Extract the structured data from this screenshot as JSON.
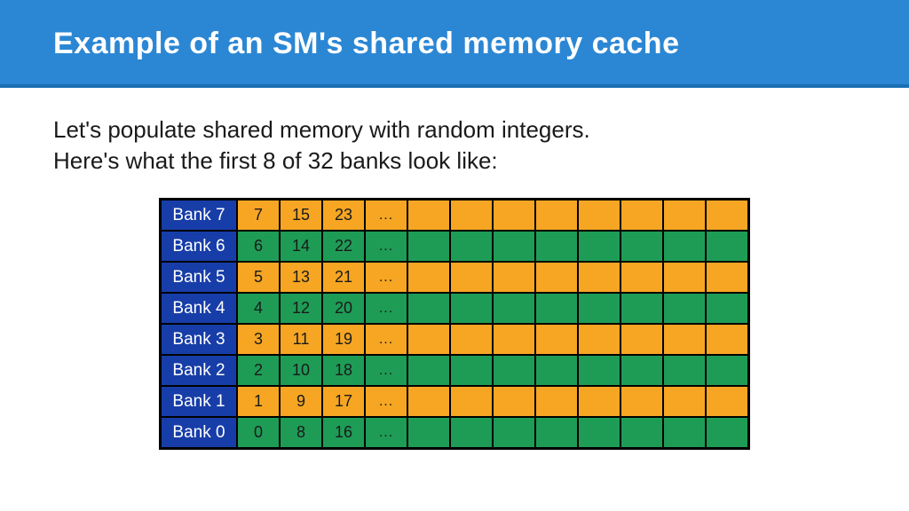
{
  "header": {
    "title": "Example of an SM's shared memory cache"
  },
  "intro": {
    "line1": "Let's populate shared memory with random integers.",
    "line2": "Here's what the first 8 of 32 banks look like:"
  },
  "colors": {
    "orange": "#f6a623",
    "green": "#1e9c56",
    "blue": "#173da8"
  },
  "chart_data": {
    "type": "table",
    "title": "First 8 of 32 shared-memory banks",
    "columns_shown": 12,
    "rows": [
      {
        "label": "Bank 7",
        "color": "orange",
        "cells": [
          "7",
          "15",
          "23",
          "..."
        ]
      },
      {
        "label": "Bank 6",
        "color": "green",
        "cells": [
          "6",
          "14",
          "22",
          "..."
        ]
      },
      {
        "label": "Bank 5",
        "color": "orange",
        "cells": [
          "5",
          "13",
          "21",
          "..."
        ]
      },
      {
        "label": "Bank 4",
        "color": "green",
        "cells": [
          "4",
          "12",
          "20",
          "..."
        ]
      },
      {
        "label": "Bank 3",
        "color": "orange",
        "cells": [
          "3",
          "11",
          "19",
          "..."
        ]
      },
      {
        "label": "Bank 2",
        "color": "green",
        "cells": [
          "2",
          "10",
          "18",
          "..."
        ]
      },
      {
        "label": "Bank 1",
        "color": "orange",
        "cells": [
          "1",
          "9",
          "17",
          "..."
        ]
      },
      {
        "label": "Bank 0",
        "color": "green",
        "cells": [
          "0",
          "8",
          "16",
          "..."
        ]
      }
    ]
  }
}
